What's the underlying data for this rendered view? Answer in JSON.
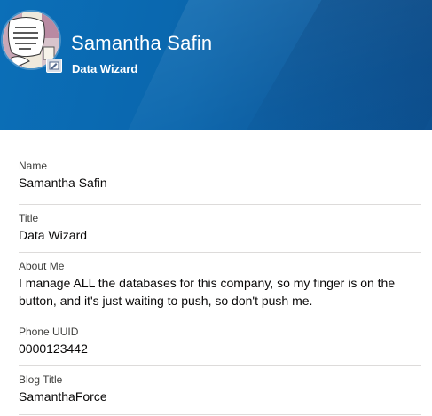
{
  "profile": {
    "name": "Samantha Safin",
    "title": "Data Wizard",
    "avatar_icon": "comic-avatar-image",
    "edit_icon": "edit-photo-icon"
  },
  "colors": {
    "header": "#0a66ad",
    "divider": "#dddbda",
    "label": "#3e3e3c",
    "value": "#080707"
  },
  "fields": [
    {
      "label": "Name",
      "value": "Samantha Safin"
    },
    {
      "label": "Title",
      "value": "Data Wizard"
    },
    {
      "label": "About Me",
      "value": "I manage ALL the databases for this company, so my finger is on the button, and it's just waiting to push, so don't push me."
    },
    {
      "label": "Phone UUID",
      "value": "0000123442"
    },
    {
      "label": "Blog Title",
      "value": "SamanthaForce"
    }
  ]
}
